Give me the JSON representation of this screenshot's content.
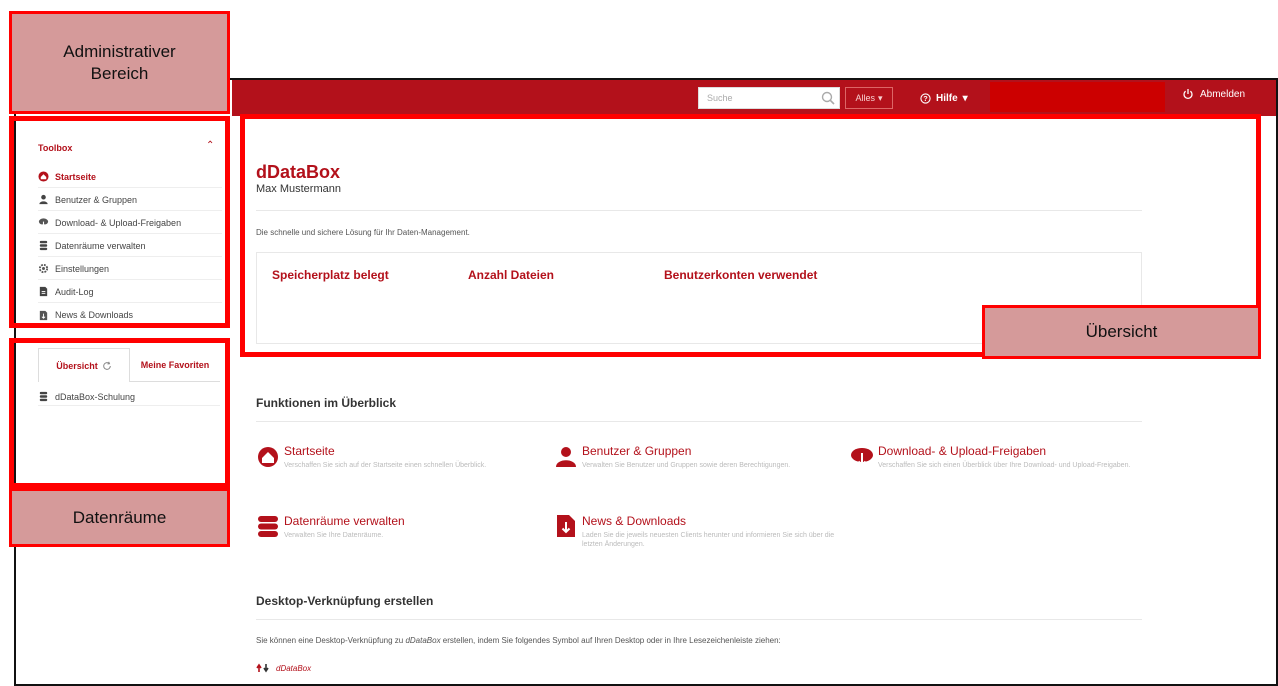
{
  "annotations": {
    "admin": "Administrativer Bereich",
    "datarooms": "Datenräume",
    "overview": "Übersicht"
  },
  "header": {
    "search_placeholder": "Suche",
    "scope_select": "Alles",
    "help": "Hilfe",
    "logout": "Abmelden"
  },
  "sidebar": {
    "toolbox_title": "Toolbox",
    "items": [
      {
        "label": "Startseite",
        "icon": "home-icon"
      },
      {
        "label": "Benutzer & Gruppen",
        "icon": "users-icon"
      },
      {
        "label": "Download- & Upload-Freigaben",
        "icon": "share-icon"
      },
      {
        "label": "Datenräume verwalten",
        "icon": "database-icon"
      },
      {
        "label": "Einstellungen",
        "icon": "gear-icon"
      },
      {
        "label": "Audit-Log",
        "icon": "log-icon"
      },
      {
        "label": "News & Downloads",
        "icon": "news-icon"
      }
    ],
    "tabs": [
      {
        "label": "Übersicht"
      },
      {
        "label": "Meine Favoriten"
      }
    ],
    "rooms": [
      {
        "label": "dDataBox-Schulung"
      }
    ]
  },
  "main": {
    "app_title": "dDataBox",
    "user_name": "Max Mustermann",
    "tagline": "Die schnelle und sichere Lösung für Ihr Daten-Management.",
    "stats": [
      {
        "label": "Speicherplatz belegt"
      },
      {
        "label": "Anzahl Dateien"
      },
      {
        "label": "Benutzerkonten verwendet"
      }
    ],
    "features_title": "Funktionen im Überblick",
    "features": [
      {
        "title": "Startseite",
        "desc": "Verschaffen Sie sich auf der Startseite einen schnellen Überblick."
      },
      {
        "title": "Benutzer & Gruppen",
        "desc": "Verwalten Sie Benutzer und Gruppen sowie deren Berechtigungen."
      },
      {
        "title": "Download- & Upload-Freigaben",
        "desc": "Verschaffen Sie sich einen Überblick über Ihre Download- und Upload-Freigaben."
      },
      {
        "title": "Datenräume verwalten",
        "desc": "Verwalten Sie Ihre Datenräume."
      },
      {
        "title": "News & Downloads",
        "desc": "Laden Sie die jeweils neuesten Clients herunter und informieren Sie sich über die letzten Änderungen."
      }
    ],
    "shortcut_title": "Desktop-Verknüpfung erstellen",
    "shortcut_text_pre": "Sie können eine Desktop-Verknüpfung zu ",
    "shortcut_text_brand": "dDataBox",
    "shortcut_text_post": " erstellen, indem Sie folgendes Symbol auf Ihren Desktop oder in Ihre Lesezeichenleiste ziehen:",
    "shortcut_link": "dDataBox"
  },
  "colors": {
    "brand": "#b3111b",
    "annotation": "#ff0000",
    "annotation_fill": "#d59a9a"
  }
}
